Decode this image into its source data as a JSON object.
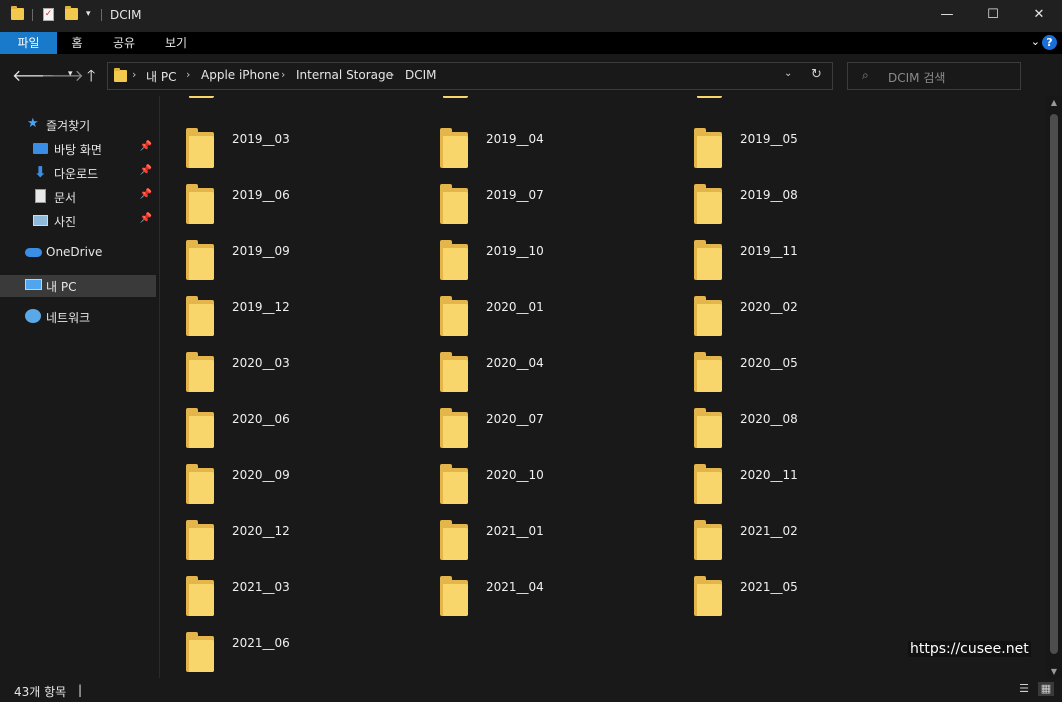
{
  "window": {
    "title": "DCIM",
    "controls": {
      "minimize": "—",
      "maximize": "☐",
      "close": "✕"
    }
  },
  "ribbon": {
    "tabs": [
      "파일",
      "홈",
      "공유",
      "보기"
    ],
    "help": "?",
    "collapse": "⌄"
  },
  "address": {
    "crumbs": [
      "내 PC",
      "Apple iPhone",
      "Internal Storage",
      "DCIM"
    ],
    "separator": "›"
  },
  "search": {
    "placeholder": "DCIM 검색"
  },
  "sidebar": {
    "quick_access": "즐겨찾기",
    "pinned": [
      "바탕 화면",
      "다운로드",
      "문서",
      "사진"
    ],
    "onedrive": "OneDrive",
    "this_pc": "내 PC",
    "network": "네트워크"
  },
  "folders": [
    "2019__03",
    "2019__04",
    "2019__05",
    "2019__06",
    "2019__07",
    "2019__08",
    "2019__09",
    "2019__10",
    "2019__11",
    "2019__12",
    "2020__01",
    "2020__02",
    "2020__03",
    "2020__04",
    "2020__05",
    "2020__06",
    "2020__07",
    "2020__08",
    "2020__09",
    "2020__10",
    "2020__11",
    "2020__12",
    "2021__01",
    "2021__02",
    "2021__03",
    "2021__04",
    "2021__05",
    "2021__06"
  ],
  "watermark": "https://cusee.net",
  "status": {
    "count": "43개 항목",
    "separator": "|"
  },
  "colors": {
    "accent": "#1979ca",
    "folder": "#f8d66b",
    "background": "#191919"
  }
}
